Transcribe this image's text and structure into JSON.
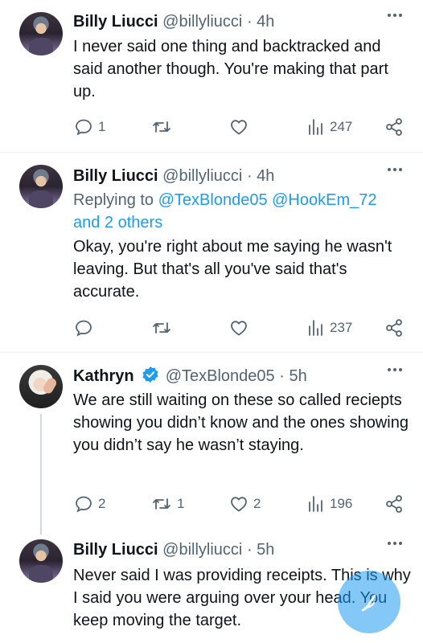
{
  "tweets": [
    {
      "name": "Billy Liucci",
      "handle": "@billyliucci",
      "time": "4h",
      "text": "I never said one thing and backtracked and said another though. You're making that part up.",
      "replies": "1",
      "retweets": "",
      "likes": "",
      "views": "247"
    },
    {
      "name": "Billy Liucci",
      "handle": "@billyliucci",
      "time": "4h",
      "replying_prefix": "Replying to",
      "replying_to": "@TexBlonde05 @HookEm_72",
      "replying_others": "and 2 others",
      "text": "Okay, you're right about me saying he wasn't leaving. But that's all you've said that's accurate.",
      "replies": "",
      "retweets": "",
      "likes": "",
      "views": "237"
    },
    {
      "name": "Kathryn",
      "handle": "@TexBlonde05",
      "time": "5h",
      "text": "We are still waiting on these so called reciepts showing you didn’t know and the ones showing you didn’t say he wasn’t staying.",
      "replies": "2",
      "retweets": "1",
      "likes": "2",
      "views": "196"
    },
    {
      "name": "Billy Liucci",
      "handle": "@billyliucci",
      "time": "5h",
      "text": "Never said I was providing receipts. This is why I said you were arguing over your head. You keep moving the target."
    }
  ],
  "separator": "·",
  "icons": {
    "reply": "reply-icon",
    "retweet": "retweet-icon",
    "like": "heart-icon",
    "views": "views-chart-icon",
    "share": "share-icon",
    "more": "more-options-icon",
    "verified": "verified-badge-icon",
    "compose": "compose-icon"
  },
  "colors": {
    "accent": "#1d9bf0",
    "muted": "#536471",
    "text": "#0f1419"
  }
}
